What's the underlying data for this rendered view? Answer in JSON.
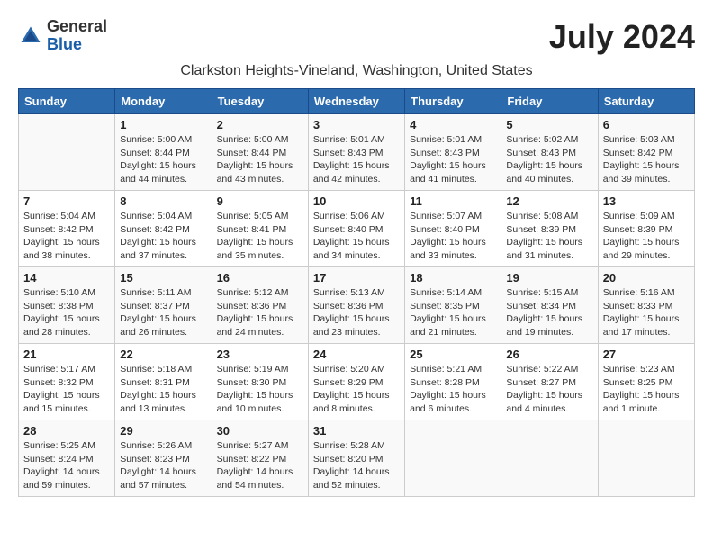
{
  "header": {
    "logo_general": "General",
    "logo_blue": "Blue",
    "month_title": "July 2024",
    "location": "Clarkston Heights-Vineland, Washington, United States"
  },
  "days_of_week": [
    "Sunday",
    "Monday",
    "Tuesday",
    "Wednesday",
    "Thursday",
    "Friday",
    "Saturday"
  ],
  "weeks": [
    [
      {
        "day": "",
        "info": ""
      },
      {
        "day": "1",
        "info": "Sunrise: 5:00 AM\nSunset: 8:44 PM\nDaylight: 15 hours\nand 44 minutes."
      },
      {
        "day": "2",
        "info": "Sunrise: 5:00 AM\nSunset: 8:44 PM\nDaylight: 15 hours\nand 43 minutes."
      },
      {
        "day": "3",
        "info": "Sunrise: 5:01 AM\nSunset: 8:43 PM\nDaylight: 15 hours\nand 42 minutes."
      },
      {
        "day": "4",
        "info": "Sunrise: 5:01 AM\nSunset: 8:43 PM\nDaylight: 15 hours\nand 41 minutes."
      },
      {
        "day": "5",
        "info": "Sunrise: 5:02 AM\nSunset: 8:43 PM\nDaylight: 15 hours\nand 40 minutes."
      },
      {
        "day": "6",
        "info": "Sunrise: 5:03 AM\nSunset: 8:42 PM\nDaylight: 15 hours\nand 39 minutes."
      }
    ],
    [
      {
        "day": "7",
        "info": "Sunrise: 5:04 AM\nSunset: 8:42 PM\nDaylight: 15 hours\nand 38 minutes."
      },
      {
        "day": "8",
        "info": "Sunrise: 5:04 AM\nSunset: 8:42 PM\nDaylight: 15 hours\nand 37 minutes."
      },
      {
        "day": "9",
        "info": "Sunrise: 5:05 AM\nSunset: 8:41 PM\nDaylight: 15 hours\nand 35 minutes."
      },
      {
        "day": "10",
        "info": "Sunrise: 5:06 AM\nSunset: 8:40 PM\nDaylight: 15 hours\nand 34 minutes."
      },
      {
        "day": "11",
        "info": "Sunrise: 5:07 AM\nSunset: 8:40 PM\nDaylight: 15 hours\nand 33 minutes."
      },
      {
        "day": "12",
        "info": "Sunrise: 5:08 AM\nSunset: 8:39 PM\nDaylight: 15 hours\nand 31 minutes."
      },
      {
        "day": "13",
        "info": "Sunrise: 5:09 AM\nSunset: 8:39 PM\nDaylight: 15 hours\nand 29 minutes."
      }
    ],
    [
      {
        "day": "14",
        "info": "Sunrise: 5:10 AM\nSunset: 8:38 PM\nDaylight: 15 hours\nand 28 minutes."
      },
      {
        "day": "15",
        "info": "Sunrise: 5:11 AM\nSunset: 8:37 PM\nDaylight: 15 hours\nand 26 minutes."
      },
      {
        "day": "16",
        "info": "Sunrise: 5:12 AM\nSunset: 8:36 PM\nDaylight: 15 hours\nand 24 minutes."
      },
      {
        "day": "17",
        "info": "Sunrise: 5:13 AM\nSunset: 8:36 PM\nDaylight: 15 hours\nand 23 minutes."
      },
      {
        "day": "18",
        "info": "Sunrise: 5:14 AM\nSunset: 8:35 PM\nDaylight: 15 hours\nand 21 minutes."
      },
      {
        "day": "19",
        "info": "Sunrise: 5:15 AM\nSunset: 8:34 PM\nDaylight: 15 hours\nand 19 minutes."
      },
      {
        "day": "20",
        "info": "Sunrise: 5:16 AM\nSunset: 8:33 PM\nDaylight: 15 hours\nand 17 minutes."
      }
    ],
    [
      {
        "day": "21",
        "info": "Sunrise: 5:17 AM\nSunset: 8:32 PM\nDaylight: 15 hours\nand 15 minutes."
      },
      {
        "day": "22",
        "info": "Sunrise: 5:18 AM\nSunset: 8:31 PM\nDaylight: 15 hours\nand 13 minutes."
      },
      {
        "day": "23",
        "info": "Sunrise: 5:19 AM\nSunset: 8:30 PM\nDaylight: 15 hours\nand 10 minutes."
      },
      {
        "day": "24",
        "info": "Sunrise: 5:20 AM\nSunset: 8:29 PM\nDaylight: 15 hours\nand 8 minutes."
      },
      {
        "day": "25",
        "info": "Sunrise: 5:21 AM\nSunset: 8:28 PM\nDaylight: 15 hours\nand 6 minutes."
      },
      {
        "day": "26",
        "info": "Sunrise: 5:22 AM\nSunset: 8:27 PM\nDaylight: 15 hours\nand 4 minutes."
      },
      {
        "day": "27",
        "info": "Sunrise: 5:23 AM\nSunset: 8:25 PM\nDaylight: 15 hours\nand 1 minute."
      }
    ],
    [
      {
        "day": "28",
        "info": "Sunrise: 5:25 AM\nSunset: 8:24 PM\nDaylight: 14 hours\nand 59 minutes."
      },
      {
        "day": "29",
        "info": "Sunrise: 5:26 AM\nSunset: 8:23 PM\nDaylight: 14 hours\nand 57 minutes."
      },
      {
        "day": "30",
        "info": "Sunrise: 5:27 AM\nSunset: 8:22 PM\nDaylight: 14 hours\nand 54 minutes."
      },
      {
        "day": "31",
        "info": "Sunrise: 5:28 AM\nSunset: 8:20 PM\nDaylight: 14 hours\nand 52 minutes."
      },
      {
        "day": "",
        "info": ""
      },
      {
        "day": "",
        "info": ""
      },
      {
        "day": "",
        "info": ""
      }
    ]
  ]
}
